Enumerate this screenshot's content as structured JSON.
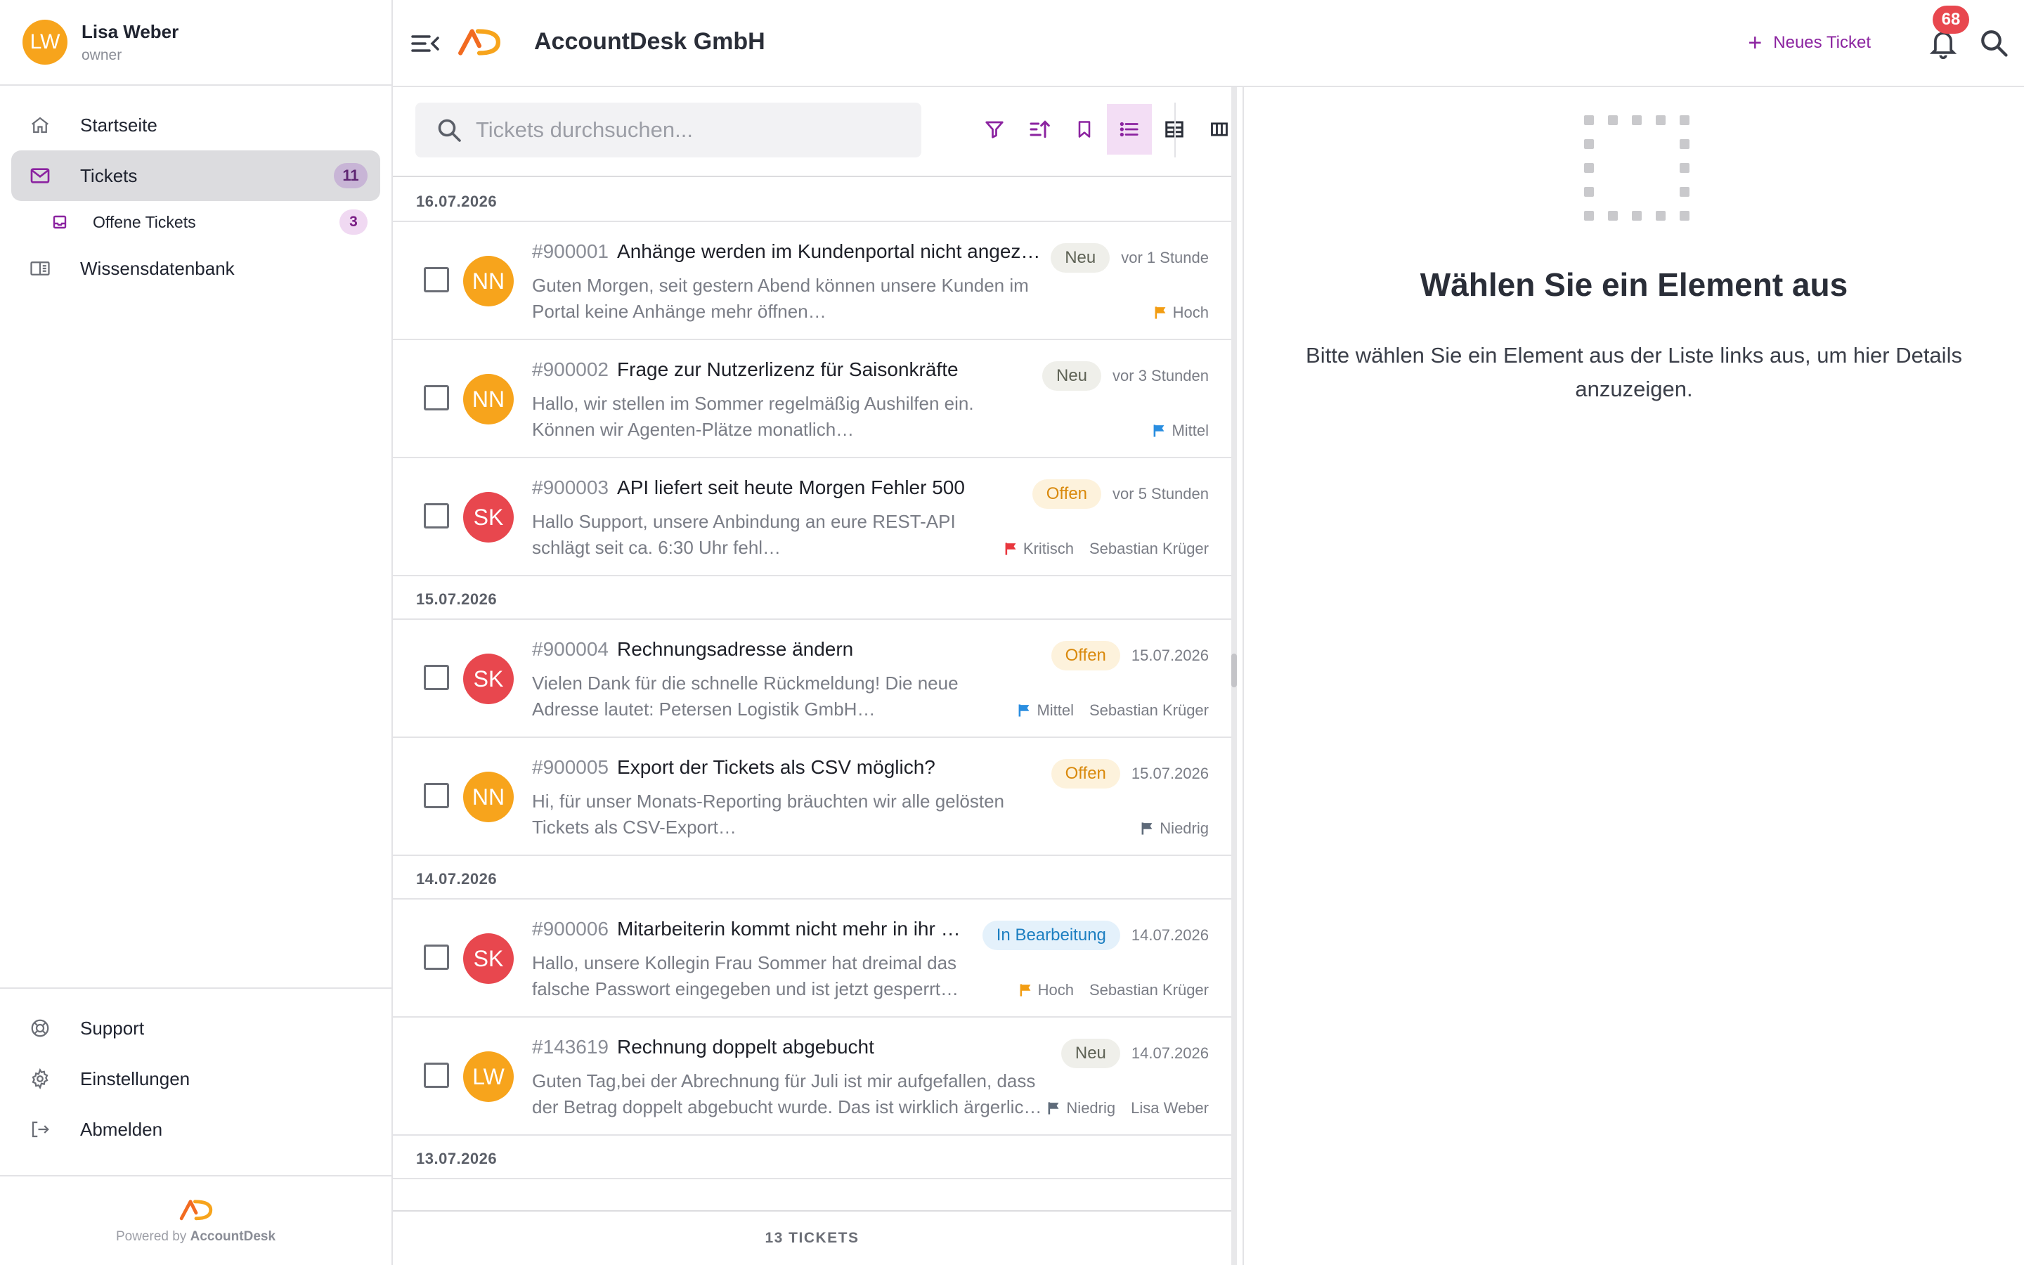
{
  "user": {
    "initials": "LW",
    "name": "Lisa Weber",
    "role": "owner"
  },
  "nav": {
    "home": "Startseite",
    "tickets": "Tickets",
    "tickets_count": "11",
    "open_tickets": "Offene Tickets",
    "open_tickets_count": "3",
    "knowledge": "Wissensdatenbank",
    "support": "Support",
    "settings": "Einstellungen",
    "logout": "Abmelden"
  },
  "footer": {
    "powered_prefix": "Powered by ",
    "brand": "AccountDesk"
  },
  "topbar": {
    "company": "AccountDesk GmbH",
    "new_ticket": "Neues Ticket",
    "notifications": "68"
  },
  "search": {
    "placeholder": "Tickets durchsuchen..."
  },
  "groups": [
    {
      "date": "16.07.2026",
      "tickets": [
        {
          "initials": "NN",
          "avatar_color": "#f7a41c",
          "number": "#900001",
          "subject": "Anhänge werden im Kundenportal nicht angez…",
          "preview1": "Guten Morgen, seit gestern Abend können unsere Kunden im",
          "preview2": "Portal keine Anhänge mehr öffnen…",
          "status": "Neu",
          "time": "vor 1 Stunde",
          "priority": "Hoch",
          "assignee": ""
        },
        {
          "initials": "NN",
          "avatar_color": "#f7a41c",
          "number": "#900002",
          "subject": "Frage zur Nutzerlizenz für Saisonkräfte",
          "preview1": "Hallo, wir stellen im Sommer regelmäßig Aushilfen ein.",
          "preview2": "Können wir Agenten-Plätze monatlich…",
          "status": "Neu",
          "time": "vor 3 Stunden",
          "priority": "Mittel",
          "assignee": ""
        },
        {
          "initials": "SK",
          "avatar_color": "#e8474e",
          "number": "#900003",
          "subject": "API liefert seit heute Morgen Fehler 500",
          "preview1": "Hallo Support, unsere Anbindung an eure REST-API",
          "preview2": "schlägt seit ca. 6:30 Uhr fehl…",
          "status": "Offen",
          "time": "vor 5 Stunden",
          "priority": "Kritisch",
          "assignee": "Sebastian Krüger"
        }
      ]
    },
    {
      "date": "15.07.2026",
      "tickets": [
        {
          "initials": "SK",
          "avatar_color": "#e8474e",
          "number": "#900004",
          "subject": "Rechnungsadresse ändern",
          "preview1": "Vielen Dank für die schnelle Rückmeldung! Die neue",
          "preview2": "Adresse lautet: Petersen Logistik GmbH…",
          "status": "Offen",
          "time": "15.07.2026",
          "priority": "Mittel",
          "assignee": "Sebastian Krüger"
        },
        {
          "initials": "NN",
          "avatar_color": "#f7a41c",
          "number": "#900005",
          "subject": "Export der Tickets als CSV möglich?",
          "preview1": "Hi, für unser Monats-Reporting bräuchten wir alle gelösten",
          "preview2": "Tickets als CSV-Export…",
          "status": "Offen",
          "time": "15.07.2026",
          "priority": "Niedrig",
          "assignee": ""
        }
      ]
    },
    {
      "date": "14.07.2026",
      "tickets": [
        {
          "initials": "SK",
          "avatar_color": "#e8474e",
          "number": "#900006",
          "subject": "Mitarbeiterin kommt nicht mehr in ihr …",
          "preview1": "Hallo, unsere Kollegin Frau Sommer hat dreimal das",
          "preview2": "falsche Passwort eingegeben und ist jetzt gesperrt…",
          "status": "In Bearbeitung",
          "time": "14.07.2026",
          "priority": "Hoch",
          "assignee": "Sebastian Krüger"
        },
        {
          "initials": "LW",
          "avatar_color": "#f7a41c",
          "number": "#143619",
          "subject": "Rechnung doppelt abgebucht",
          "preview1": "Guten Tag,bei der Abrechnung für Juli ist mir aufgefallen, dass",
          "preview2": "der Betrag doppelt abgebucht wurde. Das ist wirklich ärgerlic…",
          "status": "Neu",
          "time": "14.07.2026",
          "priority": "Niedrig",
          "assignee": "Lisa Weber"
        }
      ]
    },
    {
      "date": "13.07.2026",
      "tickets": []
    }
  ],
  "list_footer": "13 TICKETS",
  "detail": {
    "title": "Wählen Sie ein Element aus",
    "text": "Bitte wählen Sie ein Element aus der Liste links aus, um hier Details anzuzeigen."
  },
  "colors": {
    "accent": "#8b23a0",
    "priority_hoch": "#f29d13",
    "priority_mittel": "#2a8ee0",
    "priority_kritisch": "#e8373e",
    "priority_niedrig": "#5f6b7a"
  }
}
